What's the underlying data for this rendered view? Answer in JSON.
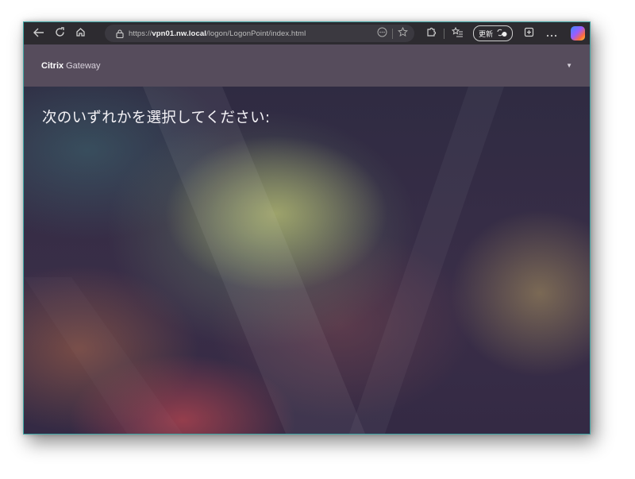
{
  "browser": {
    "address_bar": {
      "url_scheme": "https://",
      "url_host": "vpn01.nw.local",
      "url_path": "/logon/LogonPoint/index.html"
    },
    "update_label": "更新"
  },
  "app_header": {
    "brand_name": "Citrix",
    "product_name": "Gateway"
  },
  "main": {
    "prompt": "次のいずれかを選択してください:"
  },
  "colors": {
    "header_bg": "#564c5c",
    "toolbar_bg": "#2d2b30",
    "window_border": "#3fa6a6"
  }
}
